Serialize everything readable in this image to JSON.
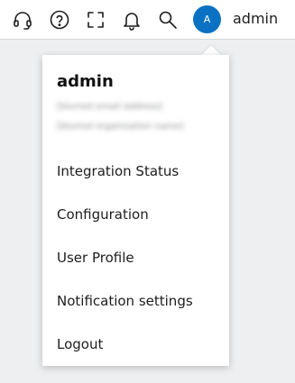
{
  "topbar": {
    "icons": [
      "headset-icon",
      "help-icon",
      "fullscreen-icon",
      "bell-icon",
      "search-icon"
    ],
    "avatar_initial": "A",
    "username": "admin"
  },
  "user_menu": {
    "name": "admin",
    "email_blurred": "[blurred email address]",
    "org_blurred": "[blurred organization name]",
    "items": [
      {
        "label": "Integration Status"
      },
      {
        "label": "Configuration"
      },
      {
        "label": "User Profile"
      },
      {
        "label": "Notification settings"
      },
      {
        "label": "Logout"
      }
    ]
  },
  "colors": {
    "accent": "#0b72c3",
    "page_background": "#eeeff1"
  }
}
